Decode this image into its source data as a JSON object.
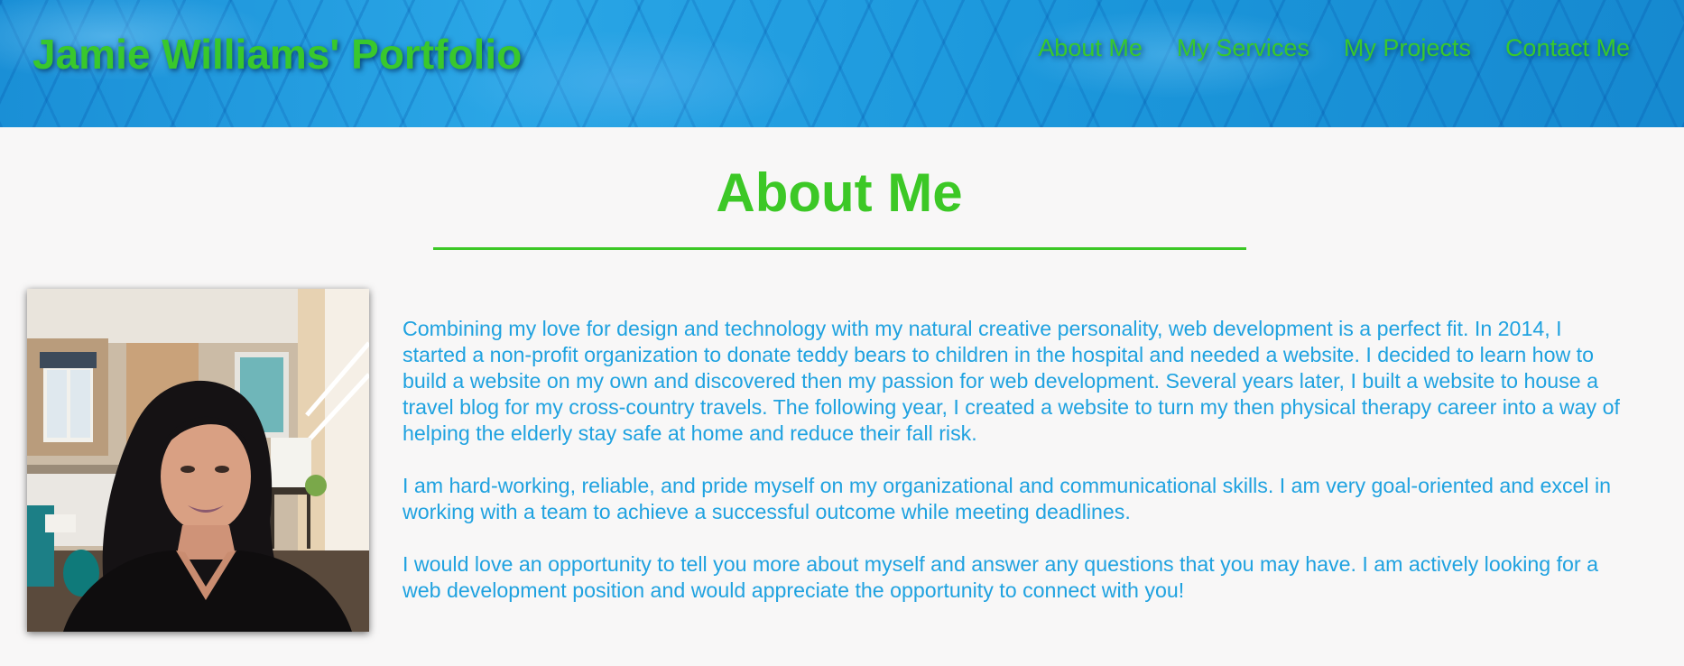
{
  "header": {
    "site_title": "Jamie Williams' Portfolio",
    "nav": [
      {
        "label": "About Me"
      },
      {
        "label": "My Services"
      },
      {
        "label": "My Projects"
      },
      {
        "label": "Contact Me"
      }
    ]
  },
  "main": {
    "heading": "About Me",
    "paragraphs": [
      "Combining my love for design and technology with my natural creative personality, web development is a perfect fit. In 2014, I started a non-profit organization to donate teddy bears to children in the hospital and needed a website. I decided to learn how to build a website on my own and discovered then my passion for web development. Several years later, I built a website to house a travel blog for my cross-country travels. The following year, I created a website to turn my then physical therapy career into a way of helping the elderly stay safe at home and reduce their fall risk.",
      "I am hard-working, reliable, and pride myself on my organizational and communicational skills. I am very goal-oriented and excel in working with a team to achieve a successful outcome while meeting deadlines.",
      "I would love an opportunity to tell you more about myself and answer any questions that you may have. I am actively looking for a web development position and would appreciate the opportunity to connect with you!"
    ]
  },
  "colors": {
    "accent_green": "#3cc826",
    "text_blue": "#1fa2e0",
    "header_blue": "#1c98dc",
    "page_background": "#f8f7f7"
  }
}
